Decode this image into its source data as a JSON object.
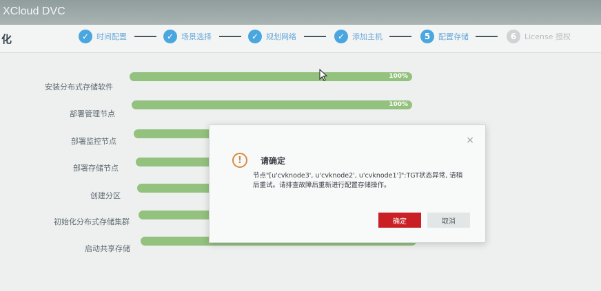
{
  "window": {
    "title": "XCloud DVC"
  },
  "header": {
    "page_title_fragment": "化",
    "steps": [
      {
        "label": "时间配置",
        "status": "done",
        "mark": "✓"
      },
      {
        "label": "场景选择",
        "status": "done",
        "mark": "✓"
      },
      {
        "label": "规划网络",
        "status": "done",
        "mark": "✓"
      },
      {
        "label": "添加主机",
        "status": "done",
        "mark": "✓"
      },
      {
        "label": "配置存储",
        "status": "current",
        "mark": "5"
      },
      {
        "label": "License 授权",
        "status": "pending",
        "mark": "6"
      }
    ]
  },
  "tasks": [
    {
      "label": "安装分布式存储软件",
      "progress": 1.0,
      "percent_text": "100%"
    },
    {
      "label": "部署管理节点",
      "progress": 1.0,
      "percent_text": "100%"
    },
    {
      "label": "部署监控节点",
      "progress": 1.0,
      "percent_text": ""
    },
    {
      "label": "部署存储节点",
      "progress": 1.0,
      "percent_text": ""
    },
    {
      "label": "创建分区",
      "progress": 1.0,
      "percent_text": ""
    },
    {
      "label": "初始化分布式存储集群",
      "progress": 1.0,
      "percent_text": ""
    },
    {
      "label": "启动共享存储",
      "progress": 1.0,
      "percent_text": ""
    }
  ],
  "dialog": {
    "title": "请确定",
    "message": "节点\"[u'cvknode3', u'cvknode2', u'cvknode1']\":TGT状态异常, 请稍后重试。请排查故障后重新进行配置存储操作。",
    "confirm_label": "确定",
    "cancel_label": "取消",
    "close_glyph": "×",
    "warning_glyph": "!"
  },
  "colors": {
    "accent": "#4aa6df",
    "progress": "#93c17e",
    "danger": "#c92025",
    "warning": "#d98a40"
  }
}
